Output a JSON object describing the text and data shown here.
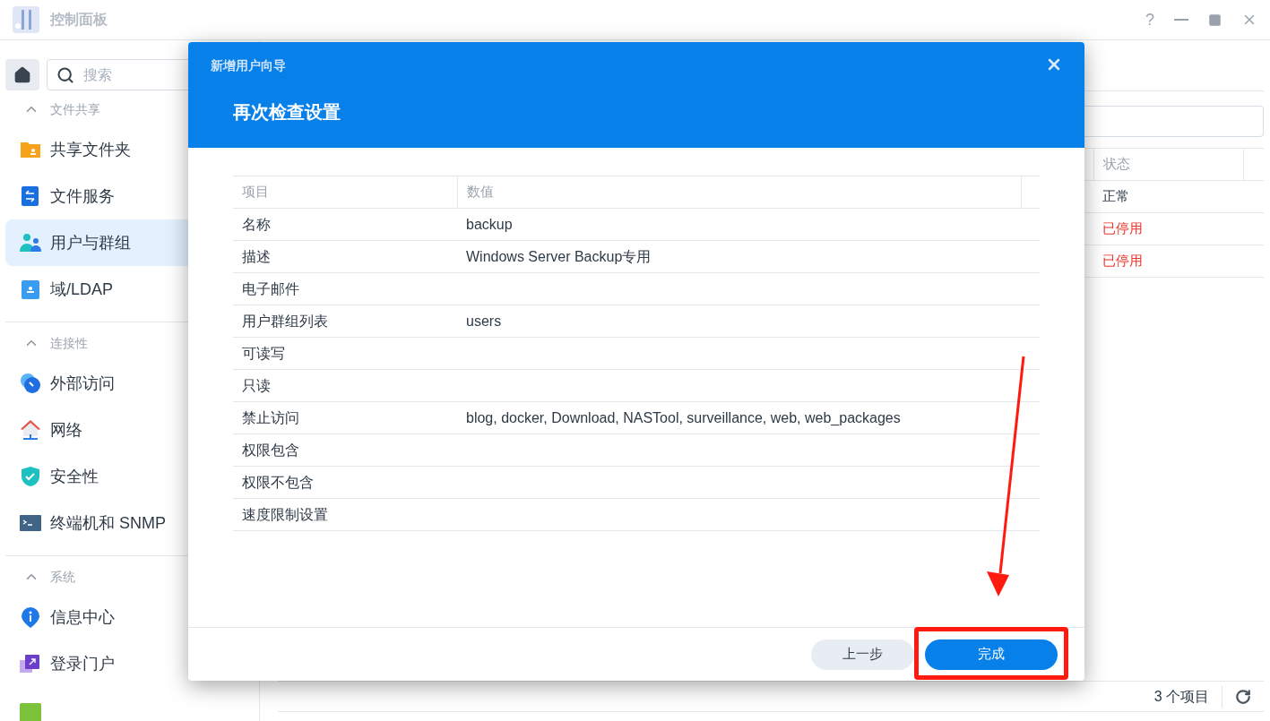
{
  "window": {
    "title": "控制面板",
    "controls": [
      "?"
    ]
  },
  "sidebar": {
    "search": {
      "placeholder": "搜索"
    },
    "sections": [
      {
        "title": "文件共享",
        "expanded": true,
        "items": [
          {
            "label": "共享文件夹",
            "selected": false
          },
          {
            "label": "文件服务",
            "selected": false
          },
          {
            "label": "用户与群组",
            "selected": true
          },
          {
            "label": "域/LDAP",
            "selected": false
          }
        ]
      },
      {
        "title": "连接性",
        "expanded": true,
        "items": [
          {
            "label": "外部访问",
            "selected": false
          },
          {
            "label": "网络",
            "selected": false
          },
          {
            "label": "安全性",
            "selected": false
          },
          {
            "label": "终端机和 SNMP",
            "selected": false
          }
        ]
      },
      {
        "title": "系统",
        "expanded": true,
        "items": [
          {
            "label": "信息中心",
            "selected": false
          },
          {
            "label": "登录门户",
            "selected": false
          }
        ]
      }
    ]
  },
  "user_table": {
    "column": "状态",
    "rows": [
      {
        "status": "正常",
        "disabled": false
      },
      {
        "status": "已停用",
        "disabled": true
      },
      {
        "status": "已停用",
        "disabled": true
      }
    ],
    "count": "3 个项目"
  },
  "dialog": {
    "title": "新增用户向导",
    "heading": "再次检查设置",
    "columns": [
      "项目",
      "数值"
    ],
    "rows": [
      {
        "item": "名称",
        "value": "backup"
      },
      {
        "item": "描述",
        "value": "Windows Server Backup专用"
      },
      {
        "item": "电子邮件"
      },
      {
        "item": "用户群组列表",
        "value": "users"
      },
      {
        "item": "可读写"
      },
      {
        "item": "只读"
      },
      {
        "item": "禁止访问",
        "value": "blog, docker, Download, NASTool, surveillance, web, web_packages"
      },
      {
        "item": "权限包含"
      },
      {
        "item": "权限不包含"
      },
      {
        "item": "速度限制设置"
      }
    ],
    "buttons": [
      {
        "label": "上一步",
        "kind": "secondary"
      },
      {
        "label": "完成",
        "kind": "primary"
      }
    ]
  }
}
